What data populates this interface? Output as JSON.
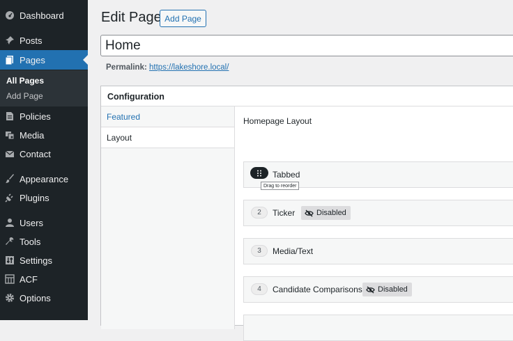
{
  "sidebar": {
    "items": [
      {
        "label": "Dashboard",
        "icon": "dashboard-icon"
      },
      {
        "label": "Posts",
        "icon": "pin-icon"
      },
      {
        "label": "Pages",
        "icon": "pages-icon"
      },
      {
        "label": "Policies",
        "icon": "document-icon"
      },
      {
        "label": "Media",
        "icon": "media-icon"
      },
      {
        "label": "Contact",
        "icon": "mail-icon"
      },
      {
        "label": "Appearance",
        "icon": "brush-icon"
      },
      {
        "label": "Plugins",
        "icon": "plug-icon"
      },
      {
        "label": "Users",
        "icon": "user-icon"
      },
      {
        "label": "Tools",
        "icon": "wrench-icon"
      },
      {
        "label": "Settings",
        "icon": "settings-icon"
      },
      {
        "label": "ACF",
        "icon": "grid-icon"
      },
      {
        "label": "Options",
        "icon": "gear-icon"
      }
    ],
    "submenu": [
      {
        "label": "All Pages",
        "current": true
      },
      {
        "label": "Add Page",
        "current": false
      }
    ],
    "active": "Pages"
  },
  "header": {
    "title": "Edit Page",
    "add_button": "Add Page"
  },
  "title_input": {
    "value": "Home"
  },
  "permalink": {
    "label": "Permalink:",
    "url": "https://lakeshore.local/"
  },
  "panel": {
    "title": "Configuration",
    "tabs": [
      {
        "label": "Featured",
        "active": false
      },
      {
        "label": "Layout",
        "active": true
      }
    ],
    "field_label": "Homepage Layout",
    "rows": [
      {
        "number": "",
        "label": "Tabbed",
        "badge": ""
      },
      {
        "number": "2",
        "label": "Ticker",
        "badge": "Disabled"
      },
      {
        "number": "3",
        "label": "Media/Text",
        "badge": ""
      },
      {
        "number": "4",
        "label": "Candidate Comparisons",
        "badge": "Disabled"
      }
    ],
    "tooltip": "Drag to reorder"
  },
  "colors": {
    "sidebar": "#1d2327",
    "accent": "#2271b1",
    "background": "#f0f0f1"
  }
}
